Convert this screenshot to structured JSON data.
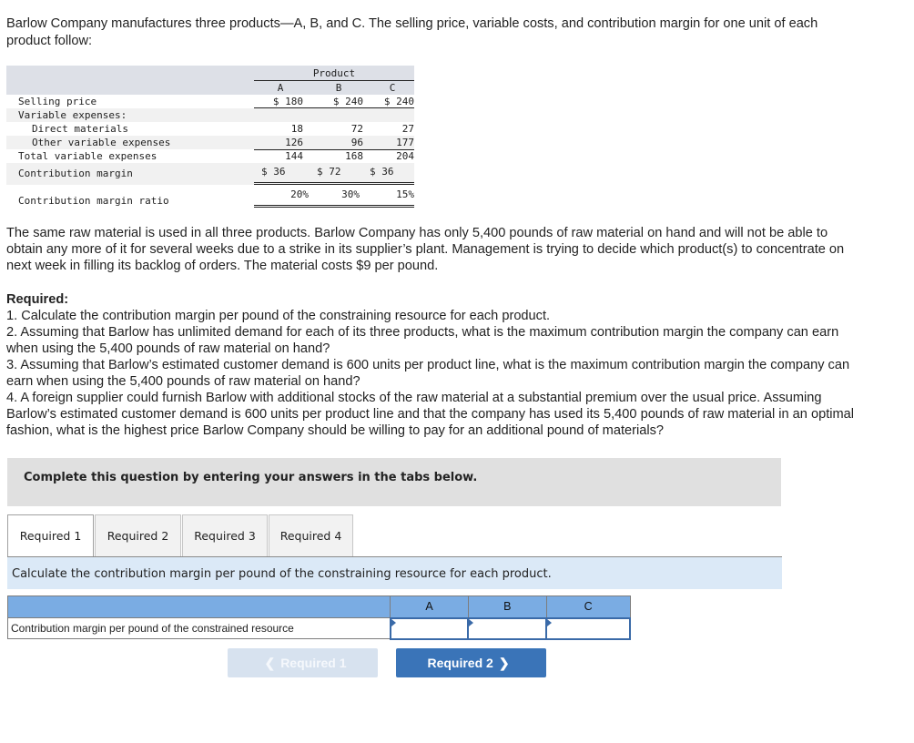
{
  "intro": "Barlow Company manufactures three products—A, B, and C. The selling price, variable costs, and contribution margin for one unit of each product follow:",
  "data_table": {
    "group_header": "Product",
    "columns": [
      "A",
      "B",
      "C"
    ],
    "rows": [
      {
        "label": "Selling price",
        "values": [
          "$ 180",
          "$ 240",
          "$ 240"
        ]
      },
      {
        "label": "Variable expenses:",
        "values": [
          "",
          "",
          ""
        ]
      },
      {
        "label": "Direct materials",
        "values": [
          "18",
          "72",
          "27"
        ]
      },
      {
        "label": "Other variable expenses",
        "values": [
          "126",
          "96",
          "177"
        ]
      },
      {
        "label": "Total variable expenses",
        "values": [
          "144",
          "168",
          "204"
        ]
      },
      {
        "label": "Contribution margin",
        "values": [
          "$ 36",
          "$ 72",
          "$ 36"
        ]
      },
      {
        "label": "Contribution margin ratio",
        "values": [
          "20%",
          "30%",
          "15%"
        ]
      }
    ]
  },
  "scenario": "The same raw material is used in all three products. Barlow Company has only 5,400 pounds of raw material on hand and will not be able to obtain any more of it for several weeks due to a strike in its supplier’s plant. Management is trying to decide which product(s) to concentrate on next week in filling its backlog of orders. The material costs $9 per pound.",
  "required": {
    "title": "Required:",
    "items": [
      "1. Calculate the contribution margin per pound of the constraining resource for each product.",
      "2. Assuming that Barlow has unlimited demand for each of its three products, what is the maximum contribution margin the company can earn when using the 5,400 pounds of raw material on hand?",
      "3. Assuming that Barlow’s estimated customer demand is 600 units per product line, what is the maximum contribution margin the company can earn when using the 5,400 pounds of raw material on hand?",
      "4. A foreign supplier could furnish Barlow with additional stocks of the raw material at a substantial premium over the usual price. Assuming Barlow’s estimated customer demand is 600 units per product line and that the company has used its 5,400 pounds of raw material in an optimal fashion, what is the highest price Barlow Company should be willing to pay for an additional pound of materials?"
    ]
  },
  "instructions": "Complete this question by entering your answers in the tabs below.",
  "tabs": [
    {
      "label": "Required 1",
      "active": true
    },
    {
      "label": "Required 2",
      "active": false
    },
    {
      "label": "Required 3",
      "active": false
    },
    {
      "label": "Required 4",
      "active": false
    }
  ],
  "tab_prompt": "Calculate the contribution margin per pound of the constraining resource for each product.",
  "answer_table": {
    "columns": [
      "A",
      "B",
      "C"
    ],
    "row_label": "Contribution margin per pound of the constrained resource",
    "values": [
      "",
      "",
      ""
    ]
  },
  "nav": {
    "prev_label": "Required 1",
    "next_label": "Required 2",
    "prev_icon": "chevron-left-icon",
    "next_icon": "chevron-right-icon"
  }
}
